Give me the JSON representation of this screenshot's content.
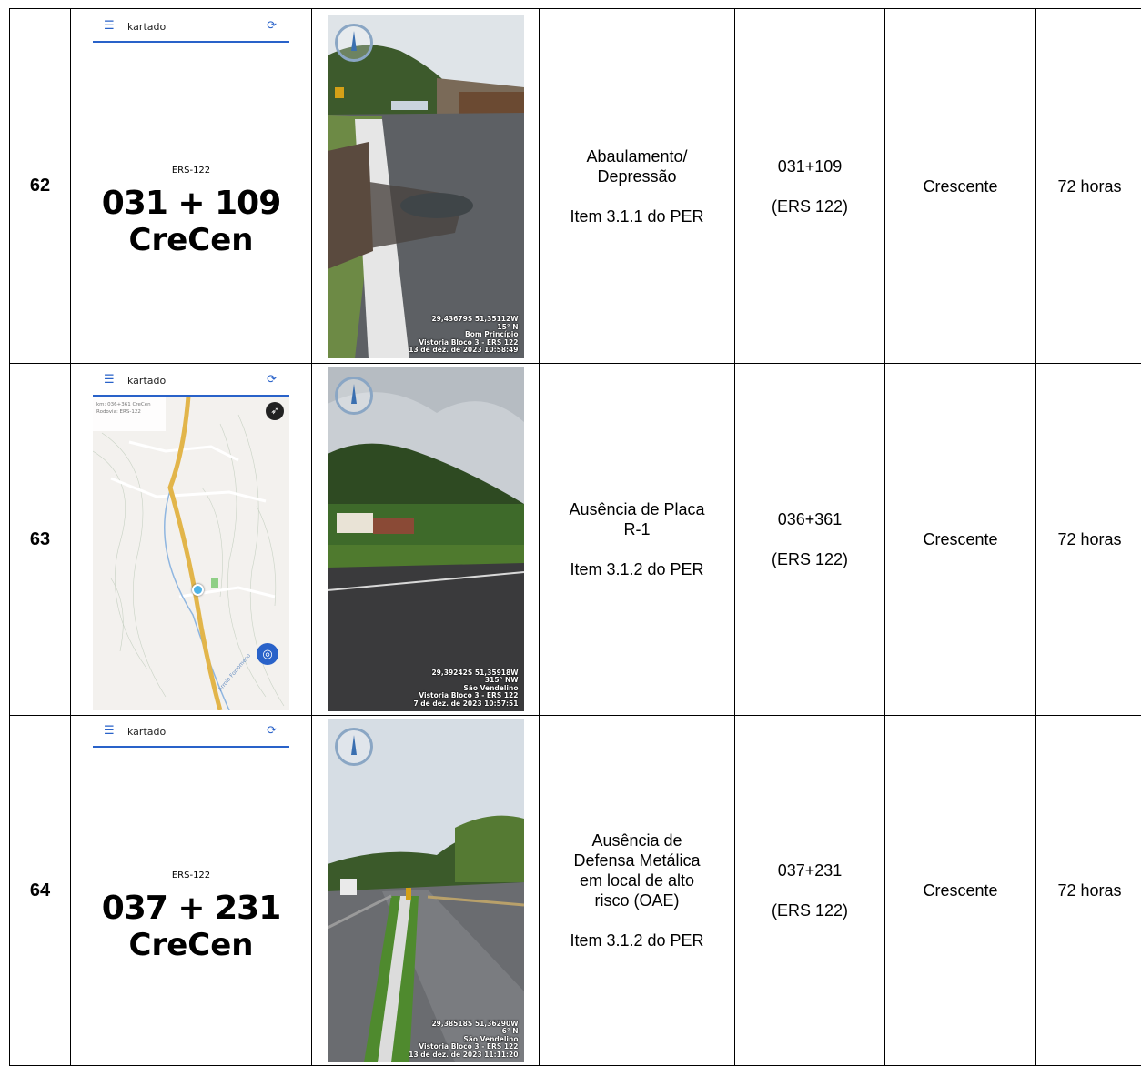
{
  "rows": [
    {
      "num": "62",
      "app": {
        "title": "kartado",
        "road": "ERS-122",
        "km": "031 + 109",
        "direction": "CreCen"
      },
      "photo": {
        "coords": "29,43679S 51,35112W",
        "heading": "15° N",
        "place": "Bom Princípio",
        "survey": "Vistoria Bloco 3 - ERS 122",
        "datetime": "13 de dez. de 2023 10:58:49"
      },
      "desc_line1": "Abaulamento/",
      "desc_line2": "Depressão",
      "desc_item": "Item 3.1.1 do PER",
      "km": "031+109",
      "road_paren": "(ERS 122)",
      "sentido": "Crescente",
      "prazo": "72 horas"
    },
    {
      "num": "63",
      "app": {
        "title": "kartado",
        "map_km": "km: 036+361 CreCen",
        "map_road": "Rodovia: ERS-122",
        "stream": "Arroio Forromeco"
      },
      "photo": {
        "coords": "29,39242S 51,35918W",
        "heading": "315° NW",
        "place": "São Vendelino",
        "survey": "Vistoria Bloco 3 - ERS 122",
        "datetime": "7 de dez. de 2023 10:57:51"
      },
      "desc_line1": "Ausência de Placa",
      "desc_line2": "R-1",
      "desc_item": "Item 3.1.2 do PER",
      "km": "036+361",
      "road_paren": "(ERS 122)",
      "sentido": "Crescente",
      "prazo": "72 horas"
    },
    {
      "num": "64",
      "app": {
        "title": "kartado",
        "road": "ERS-122",
        "km": "037 + 231",
        "direction": "CreCen"
      },
      "photo": {
        "coords": "29,38518S 51,36290W",
        "heading": "6° N",
        "place": "São Vendelino",
        "survey": "Vistoria Bloco 3 - ERS 122",
        "datetime": "13 de dez. de 2023 11:11:20"
      },
      "desc_line1": "Ausência de",
      "desc_line2": "Defensa Metálica",
      "desc_line3": "em local de alto",
      "desc_line4": "risco (OAE)",
      "desc_item": "Item 3.1.2 do PER",
      "km": "037+231",
      "road_paren": "(ERS 122)",
      "sentido": "Crescente",
      "prazo": "72 horas"
    }
  ],
  "icons": {
    "menu": "menu-icon",
    "sync": "sync-icon",
    "compass": "compass-icon",
    "locate": "locate-icon"
  },
  "colors": {
    "app_accent": "#2962c9",
    "road_line": "#e2b54a"
  }
}
